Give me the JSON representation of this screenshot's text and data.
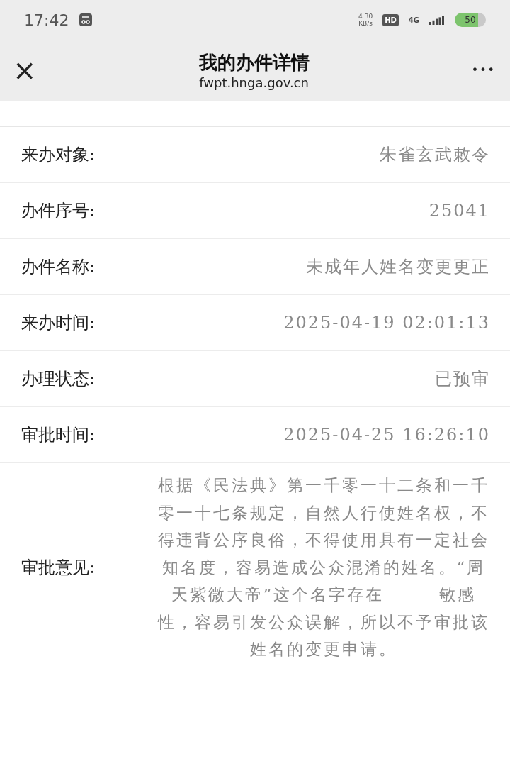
{
  "status_bar": {
    "time": "17:42",
    "net_speed": "4.30",
    "net_unit": "KB/s",
    "hd": "HD",
    "network": "4G",
    "battery": "50"
  },
  "header": {
    "close": "×",
    "title": "我的办件详情",
    "subtitle": "fwpt.hnga.gov.cn",
    "more": "•••"
  },
  "details": [
    {
      "label": "来办对象:",
      "value": "朱雀玄武敕令"
    },
    {
      "label": "办件序号:",
      "value": "25041"
    },
    {
      "label": "办件名称:",
      "value": "未成年人姓名变更更正"
    },
    {
      "label": "来办时间:",
      "value": "2025-04-19 02:01:13"
    },
    {
      "label": "办理状态:",
      "value": "已预审"
    },
    {
      "label": "审批时间:",
      "value": "2025-04-25 16:26:10"
    },
    {
      "label": "审批意见:",
      "value": "根据《民法典》第一千零一十二条和一千零一十七条规定，自然人行使姓名权，不得违背公序良俗，不得使用具有一定社会知名度，容易造成公众混淆的姓名。“周天紫微大帝”这个名字存在　　　敏感性，容易引发公众误解，所以不予审批该姓名的变更申请。"
    }
  ]
}
